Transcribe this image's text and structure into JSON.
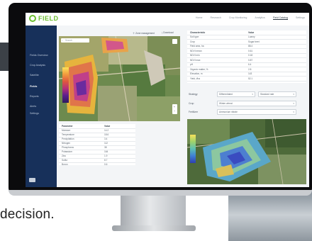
{
  "tagline": "decision.",
  "app": {
    "logo_text": "FIELD"
  },
  "topnav": [
    {
      "label": "Home"
    },
    {
      "label": "Research"
    },
    {
      "label": "Crop Monitoring"
    },
    {
      "label": "Analytics"
    },
    {
      "label": "Field Catalog",
      "active": true
    },
    {
      "label": "Settings"
    }
  ],
  "sidebar": {
    "items": [
      {
        "label": "Fields Overview"
      },
      {
        "label": "Crop Analysis"
      },
      {
        "label": "Satellite"
      },
      {
        "label": "Fields",
        "active": true
      },
      {
        "label": "Reports"
      },
      {
        "label": "Alerts"
      },
      {
        "label": "Settings"
      }
    ]
  },
  "map_toolbar": {
    "button1": "Zone management",
    "button2": "Download"
  },
  "map_search": {
    "placeholder": "Search"
  },
  "top_table": {
    "headers": [
      "Characteristic",
      "Value"
    ],
    "rows": [
      [
        "Soil type",
        "Loamy"
      ],
      [
        "Crop",
        "Sugar beet"
      ],
      [
        "Field area, ha",
        "88.4"
      ],
      [
        "NDVI mean",
        "0.61"
      ],
      [
        "NDVI min",
        "0.18"
      ],
      [
        "NDVI max",
        "0.87"
      ],
      [
        "pH",
        "6.4"
      ],
      [
        "Organic matter, %",
        "2.8"
      ],
      [
        "Elevation, m",
        "143"
      ],
      [
        "Yield, t/ha",
        "52.1"
      ]
    ]
  },
  "bottom_table": {
    "headers": [
      "Parameter",
      "Value"
    ],
    "rows": [
      [
        "Moisture",
        "14.2"
      ],
      [
        "Temperature",
        "18.6"
      ],
      [
        "Precipitation",
        "3.4"
      ],
      [
        "Nitrogen",
        "112"
      ],
      [
        "Phosphorus",
        "38"
      ],
      [
        "Potassium",
        "164"
      ],
      [
        "Zinc",
        "1.9"
      ],
      [
        "Sulfur",
        "8.7"
      ],
      [
        "Boron",
        "0.6"
      ]
    ]
  },
  "form": {
    "fields": [
      {
        "label": "Strategy",
        "value": "Differentiated",
        "value2": "Standard rate"
      },
      {
        "label": "Crop",
        "value": "Winter wheat"
      },
      {
        "label": "Fertilizer",
        "value": "Ammonium nitrate"
      }
    ]
  },
  "colors": {
    "sidebar": "#17305a",
    "brand": "#6cbf2f",
    "accent": "#2f6fb4"
  }
}
